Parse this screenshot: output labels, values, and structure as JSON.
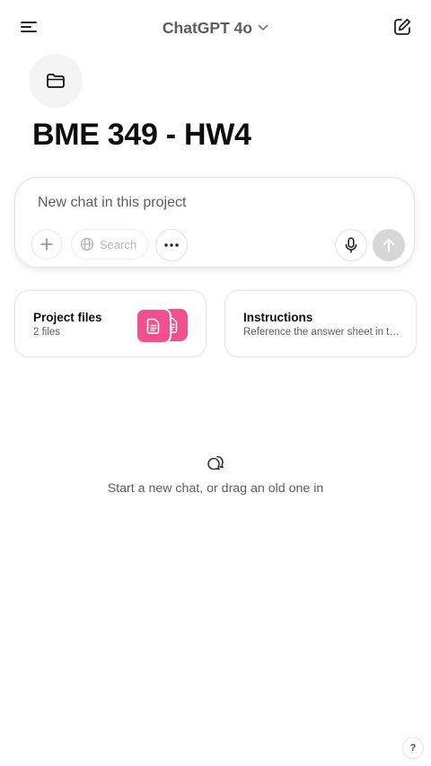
{
  "header": {
    "model_name": "ChatGPT 4o"
  },
  "project": {
    "title": "BME 349 - HW4"
  },
  "composer": {
    "placeholder": "New chat in this project",
    "search_label": "Search"
  },
  "cards": {
    "files": {
      "title": "Project files",
      "subtitle": "2 files"
    },
    "instructions": {
      "title": "Instructions",
      "subtitle": "Reference the answer sheet in the project files"
    }
  },
  "empty_state": {
    "text": "Start a new chat, or drag an old one in"
  },
  "help": {
    "label": "?"
  },
  "colors": {
    "file_tile": "#f2508c",
    "send_disabled": "#d7d7d7",
    "text_secondary": "#5d5d5d"
  },
  "icons": [
    "sidebar-menu-icon",
    "chevron-down-icon",
    "compose-icon",
    "folder-icon",
    "plus-icon",
    "globe-icon",
    "more-icon",
    "mic-icon",
    "arrow-up-icon",
    "document-icon",
    "chats-icon"
  ]
}
